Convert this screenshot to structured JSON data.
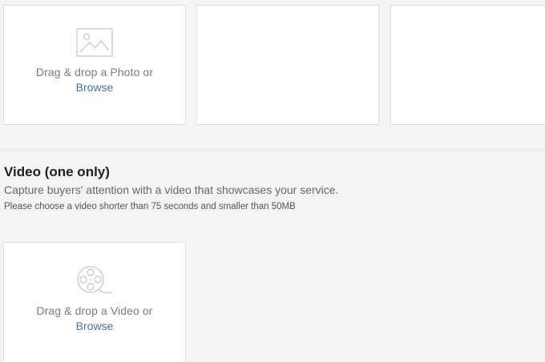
{
  "photo_gallery": {
    "tiles": [
      {
        "icon": "image-icon",
        "drop_text": "Drag & drop a Photo or",
        "browse_label": "Browse"
      },
      {},
      {}
    ]
  },
  "video_section": {
    "title": "Video (one only)",
    "description": "Capture buyers' attention with a video that showcases your service.",
    "note": "Please choose a video shorter than 75 seconds and smaller than 50MB",
    "tile": {
      "icon": "film-reel-icon",
      "drop_text": "Drag & drop a Video or",
      "browse_label": "Browse"
    }
  },
  "colors": {
    "background": "#f4f4f4",
    "tile_background": "#ffffff",
    "link": "#4a6fa5",
    "muted_text": "#7a7a7a"
  }
}
